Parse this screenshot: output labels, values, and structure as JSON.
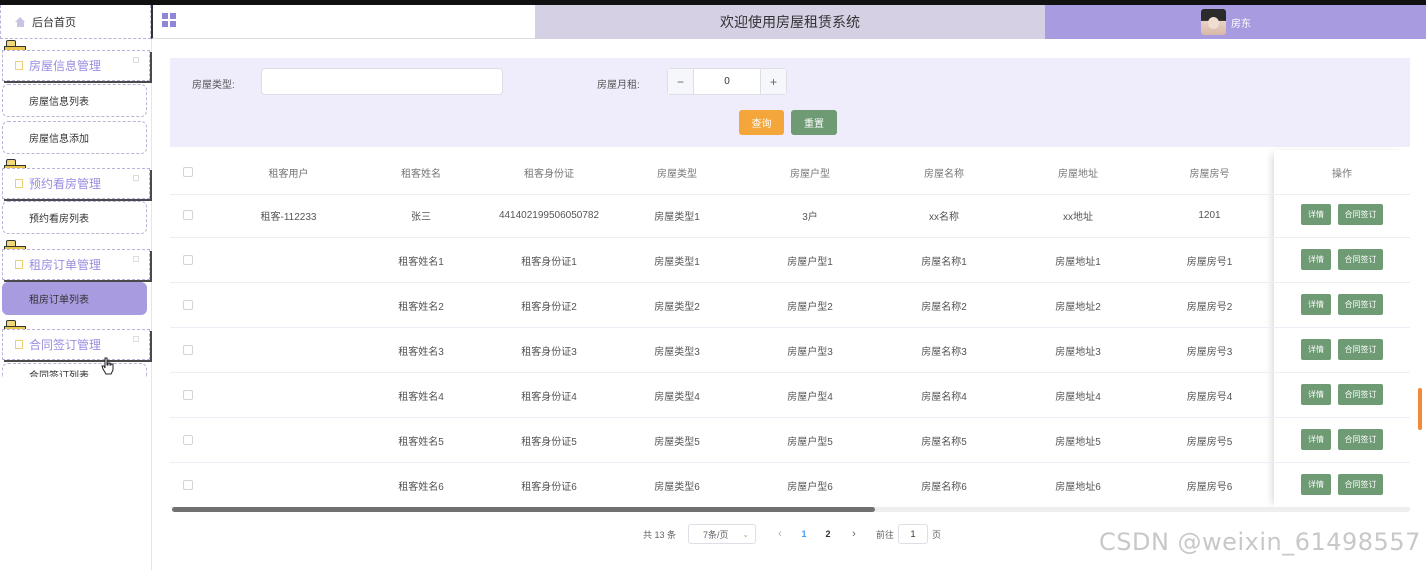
{
  "header": {
    "home_label": "后台首页",
    "system_title": "欢迎使用房屋租赁系统",
    "user_name": "房东"
  },
  "sidebar": {
    "groups": [
      {
        "label": "房屋信息管理",
        "items": [
          "房屋信息列表",
          "房屋信息添加"
        ]
      },
      {
        "label": "预约看房管理",
        "items": [
          "预约看房列表"
        ]
      },
      {
        "label": "租房订单管理",
        "items": [
          "租房订单列表"
        ],
        "active_item": "租房订单列表"
      },
      {
        "label": "合同签订管理",
        "items": [
          "合同签订列表"
        ]
      }
    ]
  },
  "search": {
    "house_type_label": "房屋类型:",
    "house_type_value": "",
    "rent_label": "房屋月租:",
    "rent_value": "0",
    "minus": "−",
    "plus": "+",
    "query_button": "查询",
    "reset_button": "重置"
  },
  "table": {
    "columns": [
      "租客用户",
      "租客姓名",
      "租客身份证",
      "房屋类型",
      "房屋户型",
      "房屋名称",
      "房屋地址",
      "房屋房号",
      "操作"
    ],
    "detail_button": "详情",
    "contract_button": "合同签订",
    "rows": [
      [
        "租客-112233",
        "张三",
        "441402199506050782",
        "房屋类型1",
        "3户",
        "xx名称",
        "xx地址",
        "1201"
      ],
      [
        "",
        "租客姓名1",
        "租客身份证1",
        "房屋类型1",
        "房屋户型1",
        "房屋名称1",
        "房屋地址1",
        "房屋房号1"
      ],
      [
        "",
        "租客姓名2",
        "租客身份证2",
        "房屋类型2",
        "房屋户型2",
        "房屋名称2",
        "房屋地址2",
        "房屋房号2"
      ],
      [
        "",
        "租客姓名3",
        "租客身份证3",
        "房屋类型3",
        "房屋户型3",
        "房屋名称3",
        "房屋地址3",
        "房屋房号3"
      ],
      [
        "",
        "租客姓名4",
        "租客身份证4",
        "房屋类型4",
        "房屋户型4",
        "房屋名称4",
        "房屋地址4",
        "房屋房号4"
      ],
      [
        "",
        "租客姓名5",
        "租客身份证5",
        "房屋类型5",
        "房屋户型5",
        "房屋名称5",
        "房屋地址5",
        "房屋房号5"
      ],
      [
        "",
        "租客姓名6",
        "租客身份证6",
        "房屋类型6",
        "房屋户型6",
        "房屋名称6",
        "房屋地址6",
        "房屋房号6"
      ]
    ]
  },
  "pagination": {
    "total": "共 13 条",
    "page_size": "7条/页",
    "prev": "‹",
    "next": "›",
    "pages": [
      "1",
      "2"
    ],
    "current_page": "1",
    "goto_label": "前往",
    "goto_value": "1",
    "goto_suffix": "页"
  },
  "watermark": "CSDN @weixin_61498557",
  "colors": {
    "accent": "#a99bdf",
    "title_bg": "#d6d0e4",
    "search_bg": "#efecfb",
    "query": "#f4a63a",
    "green": "#6e9a74"
  }
}
